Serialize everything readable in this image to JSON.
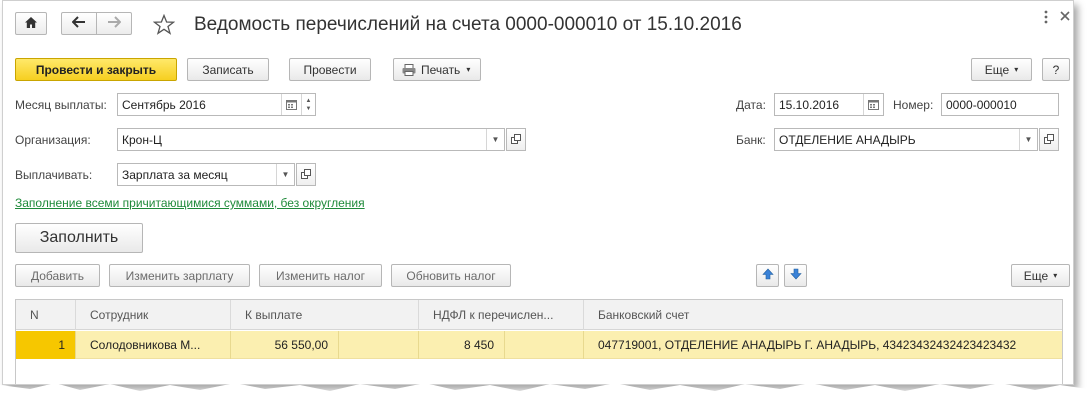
{
  "window": {
    "title": "Ведомость перечислений на счета 0000-000010 от 15.10.2016"
  },
  "toolbar": {
    "post_close_label": "Провести и закрыть",
    "save_label": "Записать",
    "post_label": "Провести",
    "print_label": "Печать",
    "more_label": "Еще",
    "help_label": "?"
  },
  "form": {
    "month_label": "Месяц выплаты:",
    "month_value": "Сентябрь 2016",
    "date_label": "Дата:",
    "date_value": "15.10.2016",
    "number_label": "Номер:",
    "number_value": "0000-000010",
    "org_label": "Организация:",
    "org_value": "Крон-Ц",
    "bank_label": "Банк:",
    "bank_value": "ОТДЕЛЕНИЕ АНАДЫРЬ",
    "pay_label": "Выплачивать:",
    "pay_value": "Зарплата за месяц",
    "fill_link": "Заполнение всеми причитающимися суммами, без округления",
    "fill_button": "Заполнить"
  },
  "table_toolbar": {
    "add_label": "Добавить",
    "change_salary_label": "Изменить зарплату",
    "change_tax_label": "Изменить налог",
    "update_tax_label": "Обновить налог",
    "more_label": "Еще"
  },
  "table": {
    "columns": [
      "N",
      "Сотрудник",
      "К выплате",
      "НДФЛ к перечислен...",
      "Банковский счет"
    ],
    "rows": [
      {
        "n": "1",
        "employee": "Солодовникова М...",
        "to_pay": "56 550,00",
        "ndfl": "8 450",
        "account": "047719001, ОТДЕЛЕНИЕ АНАДЫРЬ Г. АНАДЫРЬ, 43423432432423423432"
      }
    ]
  },
  "colors": {
    "primary_button": "#f6cf20",
    "selected_row": "#fbefb0",
    "link": "#1f8a3a",
    "arrow_blue": "#3a82d8"
  }
}
